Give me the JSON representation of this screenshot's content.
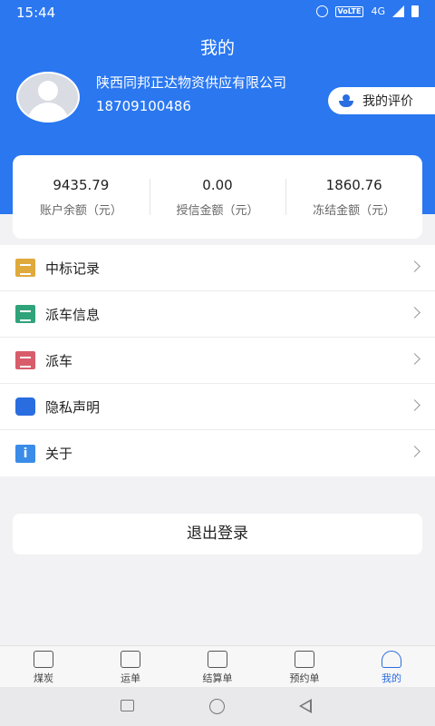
{
  "status": {
    "time": "15:44",
    "volte": "VoLTE",
    "network": "4G"
  },
  "header": {
    "title": "我的"
  },
  "profile": {
    "company": "陕西同邦正达物资供应有限公司",
    "phone": "18709100486",
    "rating_label": "我的评价"
  },
  "balances": [
    {
      "value": "9435.79",
      "label": "账户余额（元）"
    },
    {
      "value": "0.00",
      "label": "授信金额（元）"
    },
    {
      "value": "1860.76",
      "label": "冻结金额（元）"
    }
  ],
  "menu": [
    {
      "label": "中标记录",
      "icon": "list-icon",
      "color": "#e0a93b"
    },
    {
      "label": "派车信息",
      "icon": "truck-info-icon",
      "color": "#2fa37a"
    },
    {
      "label": "派车",
      "icon": "dispatch-icon",
      "color": "#d95c6a"
    },
    {
      "label": "隐私声明",
      "icon": "hand-icon",
      "color": "#2a6de0"
    },
    {
      "label": "关于",
      "icon": "info-icon",
      "color": "#3a8ce8"
    }
  ],
  "logout_label": "退出登录",
  "tabs": [
    {
      "label": "煤炭",
      "icon": "coal-icon",
      "active": false
    },
    {
      "label": "运单",
      "icon": "waybill-icon",
      "active": false
    },
    {
      "label": "结算单",
      "icon": "settlement-icon",
      "active": false
    },
    {
      "label": "预约单",
      "icon": "reservation-icon",
      "active": false
    },
    {
      "label": "我的",
      "icon": "profile-icon",
      "active": true
    }
  ],
  "colors": {
    "brand": "#2a77f0",
    "accent": "#2a6de0",
    "background": "#f2f2f4"
  }
}
